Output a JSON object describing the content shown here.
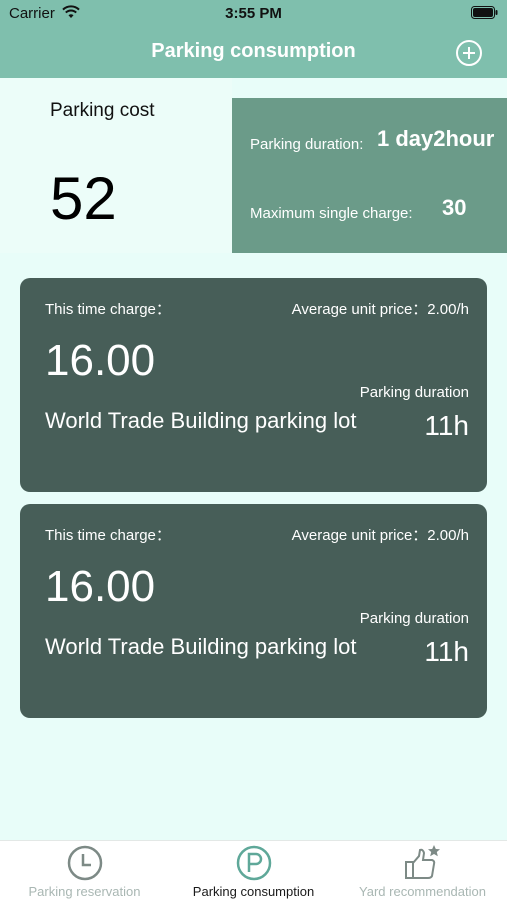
{
  "status_bar": {
    "carrier": "Carrier",
    "time": "3:55 PM"
  },
  "nav": {
    "title": "Parking consumption",
    "add_icon": "plus-circle-icon"
  },
  "cost": {
    "label": "Parking cost",
    "value": "52"
  },
  "summary": {
    "duration_label": "Parking duration:",
    "duration_value": "1 day2hour",
    "max_label": "Maximum single charge:",
    "max_value": "30"
  },
  "records": [
    {
      "charge_label": "This time charge：",
      "avg_price": "Average unit price：2.00/h",
      "amount": "16.00",
      "duration_label": "Parking duration",
      "lot": "World Trade Building parking lot",
      "duration_value": "11h"
    },
    {
      "charge_label": "This time charge：",
      "avg_price": "Average unit price：2.00/h",
      "amount": "16.00",
      "duration_label": "Parking duration",
      "lot": "World Trade Building parking lot",
      "duration_value": "11h"
    }
  ],
  "tabs": [
    {
      "label": "Parking reservation",
      "icon": "clock-icon",
      "active": false
    },
    {
      "label": "Parking consumption",
      "icon": "parking-icon",
      "active": true
    },
    {
      "label": "Yard recommendation",
      "icon": "thumbs-up-icon",
      "active": false
    }
  ],
  "colors": {
    "header": "#7fbfad",
    "background": "#e8fdf9",
    "summary_card": "#6b9b89",
    "record_card": "#475e58",
    "active_tab_icon": "#5fa899",
    "inactive_tab_icon": "#7d8a86"
  }
}
